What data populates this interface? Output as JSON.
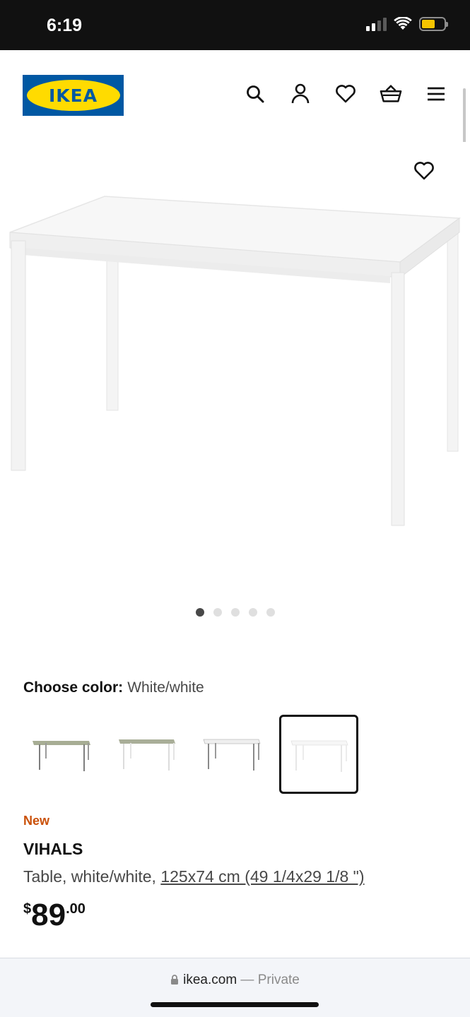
{
  "status_bar": {
    "time": "6:19"
  },
  "header": {
    "logo_text": "IKEA",
    "icons": [
      "search-icon",
      "account-icon",
      "heart-icon",
      "basket-icon",
      "menu-icon"
    ]
  },
  "product_image": {
    "carousel": {
      "count": 5,
      "active": 0
    }
  },
  "color": {
    "label": "Choose color:",
    "value": "White/white",
    "selected_index": 3
  },
  "product": {
    "badge": "New",
    "name": "VIHALS",
    "description": "Table, white/white, ",
    "dimensions": "125x74 cm (49 1/4x29 1/8 \")",
    "price": {
      "currency": "$",
      "integer": "89",
      "decimal": ".00"
    }
  },
  "browser": {
    "domain": "ikea.com",
    "separator": " — ",
    "mode": "Private"
  },
  "colors": {
    "ikea_blue": "#0058a3",
    "ikea_yellow": "#ffdb00",
    "new_badge": "#ca5008"
  }
}
